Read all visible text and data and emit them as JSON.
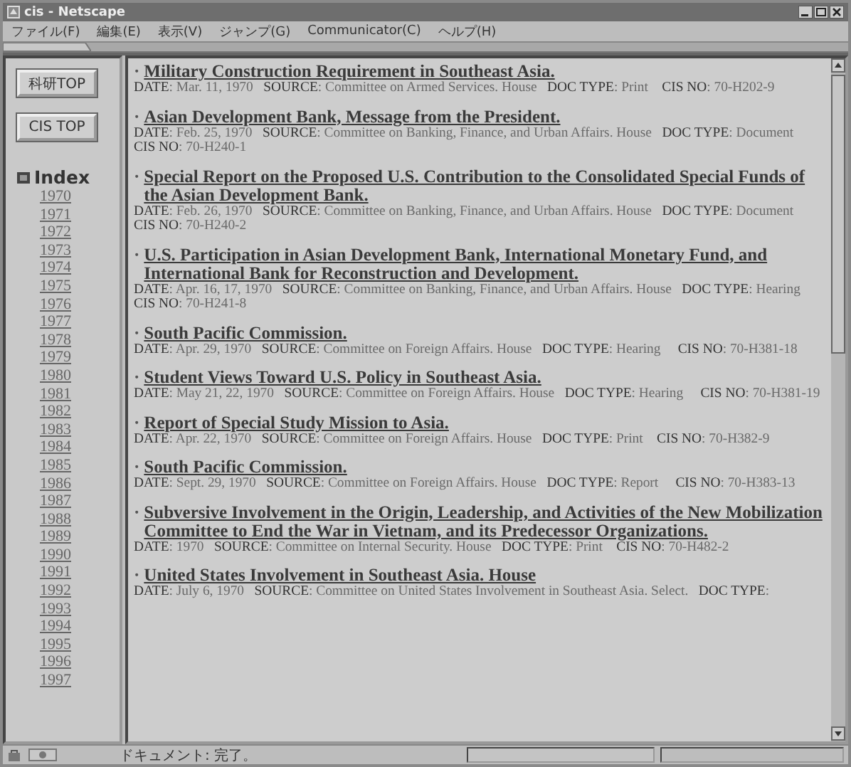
{
  "window": {
    "title": "cis - Netscape"
  },
  "menu": [
    "ファイル(F)",
    "編集(E)",
    "表示(V)",
    "ジャンプ(G)",
    "Communicator(C)",
    "ヘルプ(H)"
  ],
  "sidebar": {
    "buttons": [
      "科研TOP",
      "CIS TOP"
    ],
    "index_title": "Index",
    "years": [
      "1970",
      "1971",
      "1972",
      "1973",
      "1974",
      "1975",
      "1976",
      "1977",
      "1978",
      "1979",
      "1980",
      "1981",
      "1982",
      "1983",
      "1984",
      "1985",
      "1986",
      "1987",
      "1988",
      "1989",
      "1990",
      "1991",
      "1992",
      "1993",
      "1994",
      "1995",
      "1996",
      "1997"
    ]
  },
  "entries": [
    {
      "bullet": "·",
      "title": "Military Construction Requirement in Southeast Asia.",
      "meta": "**DATE**: Mar. 11, 1970   **SOURCE**: Committee on Armed Services. House   **DOC TYPE**: Print    **CIS NO**: 70-H202-9"
    },
    {
      "bullet": "·",
      "title": "Asian Development Bank, Message from the President.",
      "meta": "**DATE**: Feb. 25, 1970   **SOURCE**: Committee on Banking, Finance, and Urban Affairs. House   **DOC TYPE**: Document    **CIS NO**: 70-H240-1"
    },
    {
      "bullet": "·",
      "title": "Special Report on the Proposed U.S. Contribution to the Consolidated Special Funds of the Asian Development Bank.",
      "meta": "**DATE**: Feb. 26, 1970   **SOURCE**: Committee on Banking, Finance, and Urban Affairs. House   **DOC TYPE**: Document    **CIS NO**: 70-H240-2"
    },
    {
      "bullet": "·",
      "title": "U.S. Participation in Asian Development Bank, International Monetary Fund, and International Bank for Reconstruction and Development.",
      "meta": "**DATE**: Apr. 16, 17, 1970   **SOURCE**: Committee on Banking, Finance, and Urban Affairs. House   **DOC TYPE**: Hearing    **CIS NO**: 70-H241-8"
    },
    {
      "bullet": "·",
      "title": "South Pacific Commission.",
      "meta": "**DATE**: Apr. 29, 1970   **SOURCE**: Committee on Foreign Affairs. House   **DOC TYPE**: Hearing     **CIS NO**: 70-H381-18"
    },
    {
      "bullet": "·",
      "title": "Student Views Toward U.S. Policy in Southeast Asia.",
      "meta": "**DATE**: May 21, 22, 1970   **SOURCE**: Committee on Foreign Affairs. House   **DOC TYPE**: Hearing     **CIS NO**: 70-H381-19"
    },
    {
      "bullet": "·",
      "title": "Report of Special Study Mission to Asia.",
      "meta": "**DATE**: Apr. 22, 1970   **SOURCE**: Committee on Foreign Affairs. House   **DOC TYPE**: Print    **CIS NO**: 70-H382-9"
    },
    {
      "bullet": "·",
      "title": "South Pacific Commission.",
      "meta": "**DATE**: Sept. 29, 1970   **SOURCE**: Committee on Foreign Affairs. House   **DOC TYPE**: Report     **CIS NO**: 70-H383-13"
    },
    {
      "bullet": "·",
      "title": "Subversive Involvement in the Origin, Leadership, and Activities of the New Mobilization Committee to End the War in Vietnam, and its Predecessor Organizations.",
      "meta": "**DATE**: 1970   **SOURCE**: Committee on Internal Security. House   **DOC TYPE**: Print    **CIS NO**: 70-H482-2"
    },
    {
      "bullet": "·",
      "title": "United States Involvement in Southeast Asia. House",
      "meta": "**DATE**: July 6, 1970   **SOURCE**: Committee on United States Involvement in Southeast Asia. Select.   **DOC TYPE**:"
    }
  ],
  "status_bar": {
    "text": "ドキュメント: 完了。"
  }
}
